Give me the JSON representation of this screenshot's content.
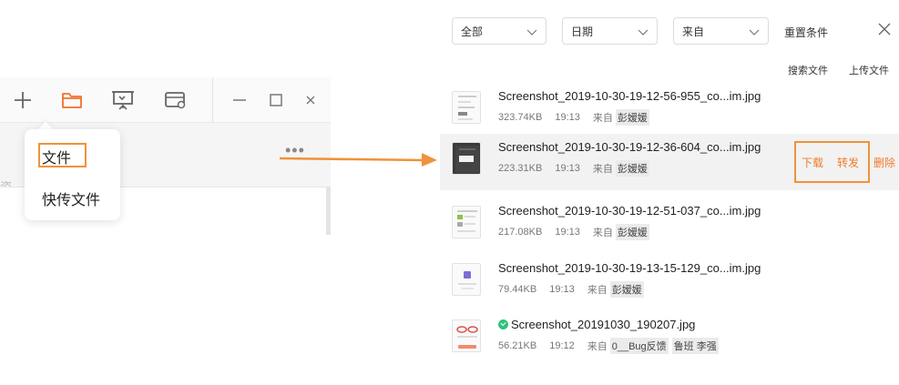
{
  "toolbar": {
    "icons": [
      "plus-icon",
      "folder-icon",
      "presentation-icon",
      "settings-panel-icon",
      "minimize-icon",
      "maximize-icon",
      "close-icon"
    ],
    "accent_color": "#f0712c"
  },
  "popup_menu": {
    "items": [
      {
        "label": "文件"
      },
      {
        "label": "快传文件"
      }
    ]
  },
  "background_text": "资",
  "more_dots": "•••",
  "file_panel": {
    "filters": [
      {
        "value": "全部"
      },
      {
        "value": "日期"
      },
      {
        "value": "来自"
      }
    ],
    "reset_label": "重置条件",
    "search_label": "搜索文件",
    "upload_label": "上传文件",
    "files": [
      {
        "name": "Screenshot_2019-10-30-19-12-56-955_co...im.jpg",
        "size": "323.74KB",
        "time": "19:13",
        "from_label": "来自",
        "tags": [
          "彭嫒媛"
        ],
        "verified": false
      },
      {
        "name": "Screenshot_2019-10-30-19-12-36-604_co...im.jpg",
        "size": "223.31KB",
        "time": "19:13",
        "from_label": "来自",
        "tags": [
          "彭嫒媛"
        ],
        "verified": false
      },
      {
        "name": "Screenshot_2019-10-30-19-12-51-037_co...im.jpg",
        "size": "217.08KB",
        "time": "19:13",
        "from_label": "来自",
        "tags": [
          "彭嫒媛"
        ],
        "verified": false
      },
      {
        "name": "Screenshot_2019-10-30-19-13-15-129_co...im.jpg",
        "size": "79.44KB",
        "time": "19:13",
        "from_label": "来自",
        "tags": [
          "彭嫒媛"
        ],
        "verified": false
      },
      {
        "name": "Screenshot_20191030_190207.jpg",
        "size": "56.21KB",
        "time": "19:12",
        "from_label": "来自",
        "tags": [
          "0__Bug反馈",
          "鲁班 李强"
        ],
        "verified": true
      }
    ],
    "row_actions": {
      "download": "下载",
      "forward": "转发",
      "delete": "删除"
    },
    "action_color": "#f07a2c",
    "highlight_color": "#f0923a"
  }
}
